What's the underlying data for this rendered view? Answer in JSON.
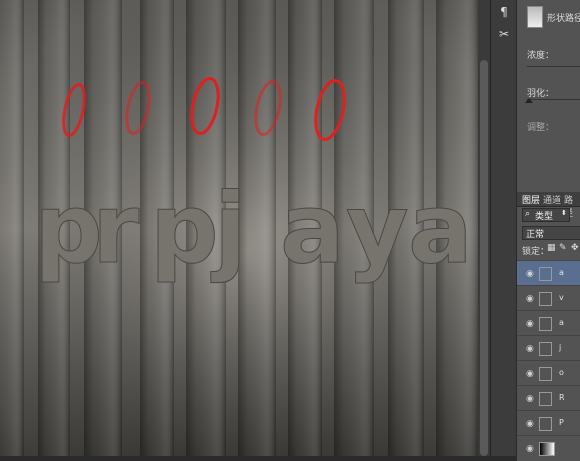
{
  "canvas": {
    "letters": [
      "p",
      "r",
      "p",
      "j",
      "a",
      "y",
      "a"
    ],
    "annotation_color": "#e01f1f"
  },
  "toolstrip": {
    "tools": [
      {
        "icon": "paragraph-icon",
        "glyph": "¶"
      },
      {
        "icon": "tools-icon",
        "glyph": "✂"
      }
    ]
  },
  "properties": {
    "shape_label": "形状路径",
    "density_label": "浓度：",
    "feather_label": "羽化：",
    "adjust_label": "调整："
  },
  "layers": {
    "tabs": [
      "图层",
      "通道",
      "路径"
    ],
    "filter_kind": "类型",
    "blend_mode": "正常",
    "lock_label": "锁定：",
    "items": [
      {
        "name": "a",
        "selected": true
      },
      {
        "name": "v",
        "selected": false
      },
      {
        "name": "a",
        "selected": false
      },
      {
        "name": "j",
        "selected": false
      },
      {
        "name": "o",
        "selected": false
      },
      {
        "name": "R",
        "selected": false
      },
      {
        "name": "P",
        "selected": false
      },
      {
        "name": "",
        "selected": false
      }
    ]
  }
}
